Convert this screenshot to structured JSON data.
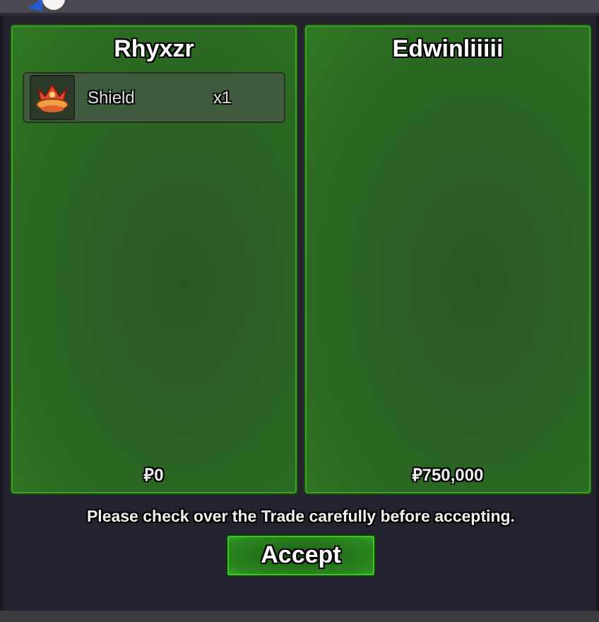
{
  "traders": [
    {
      "name": "Rhyxzr",
      "items": [
        {
          "name": "Shield",
          "quantity": "x1"
        }
      ],
      "money": "₽0"
    },
    {
      "name": "Edwinliiiii",
      "money": "₽750,000"
    }
  ],
  "message": "Please check over the Trade carefully before accepting.",
  "accept_button": "Accept"
}
